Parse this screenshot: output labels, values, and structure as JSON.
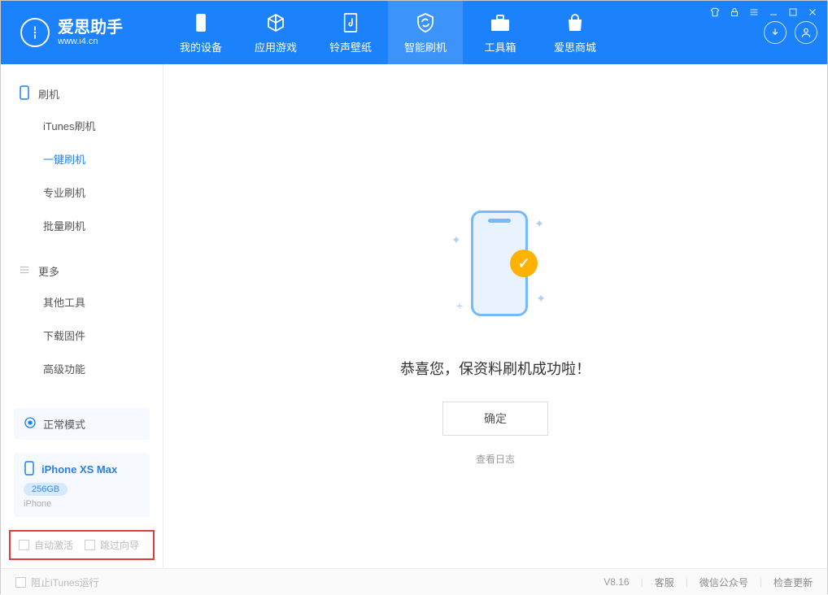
{
  "header": {
    "app_name": "爱思助手",
    "app_url": "www.i4.cn",
    "tabs": [
      {
        "label": "我的设备"
      },
      {
        "label": "应用游戏"
      },
      {
        "label": "铃声壁纸"
      },
      {
        "label": "智能刷机"
      },
      {
        "label": "工具箱"
      },
      {
        "label": "爱思商城"
      }
    ]
  },
  "sidebar": {
    "section_flash": "刷机",
    "items_flash": [
      {
        "label": "iTunes刷机"
      },
      {
        "label": "一键刷机"
      },
      {
        "label": "专业刷机"
      },
      {
        "label": "批量刷机"
      }
    ],
    "section_more": "更多",
    "items_more": [
      {
        "label": "其他工具"
      },
      {
        "label": "下载固件"
      },
      {
        "label": "高级功能"
      }
    ],
    "mode_label": "正常模式",
    "device": {
      "name": "iPhone XS Max",
      "storage": "256GB",
      "type": "iPhone"
    },
    "auto_activate": "自动激活",
    "skip_guide": "跳过向导"
  },
  "main": {
    "success_message": "恭喜您，保资料刷机成功啦！",
    "ok_button": "确定",
    "view_log": "查看日志"
  },
  "footer": {
    "block_itunes": "阻止iTunes运行",
    "version": "V8.16",
    "links": [
      "客服",
      "微信公众号",
      "检查更新"
    ]
  }
}
